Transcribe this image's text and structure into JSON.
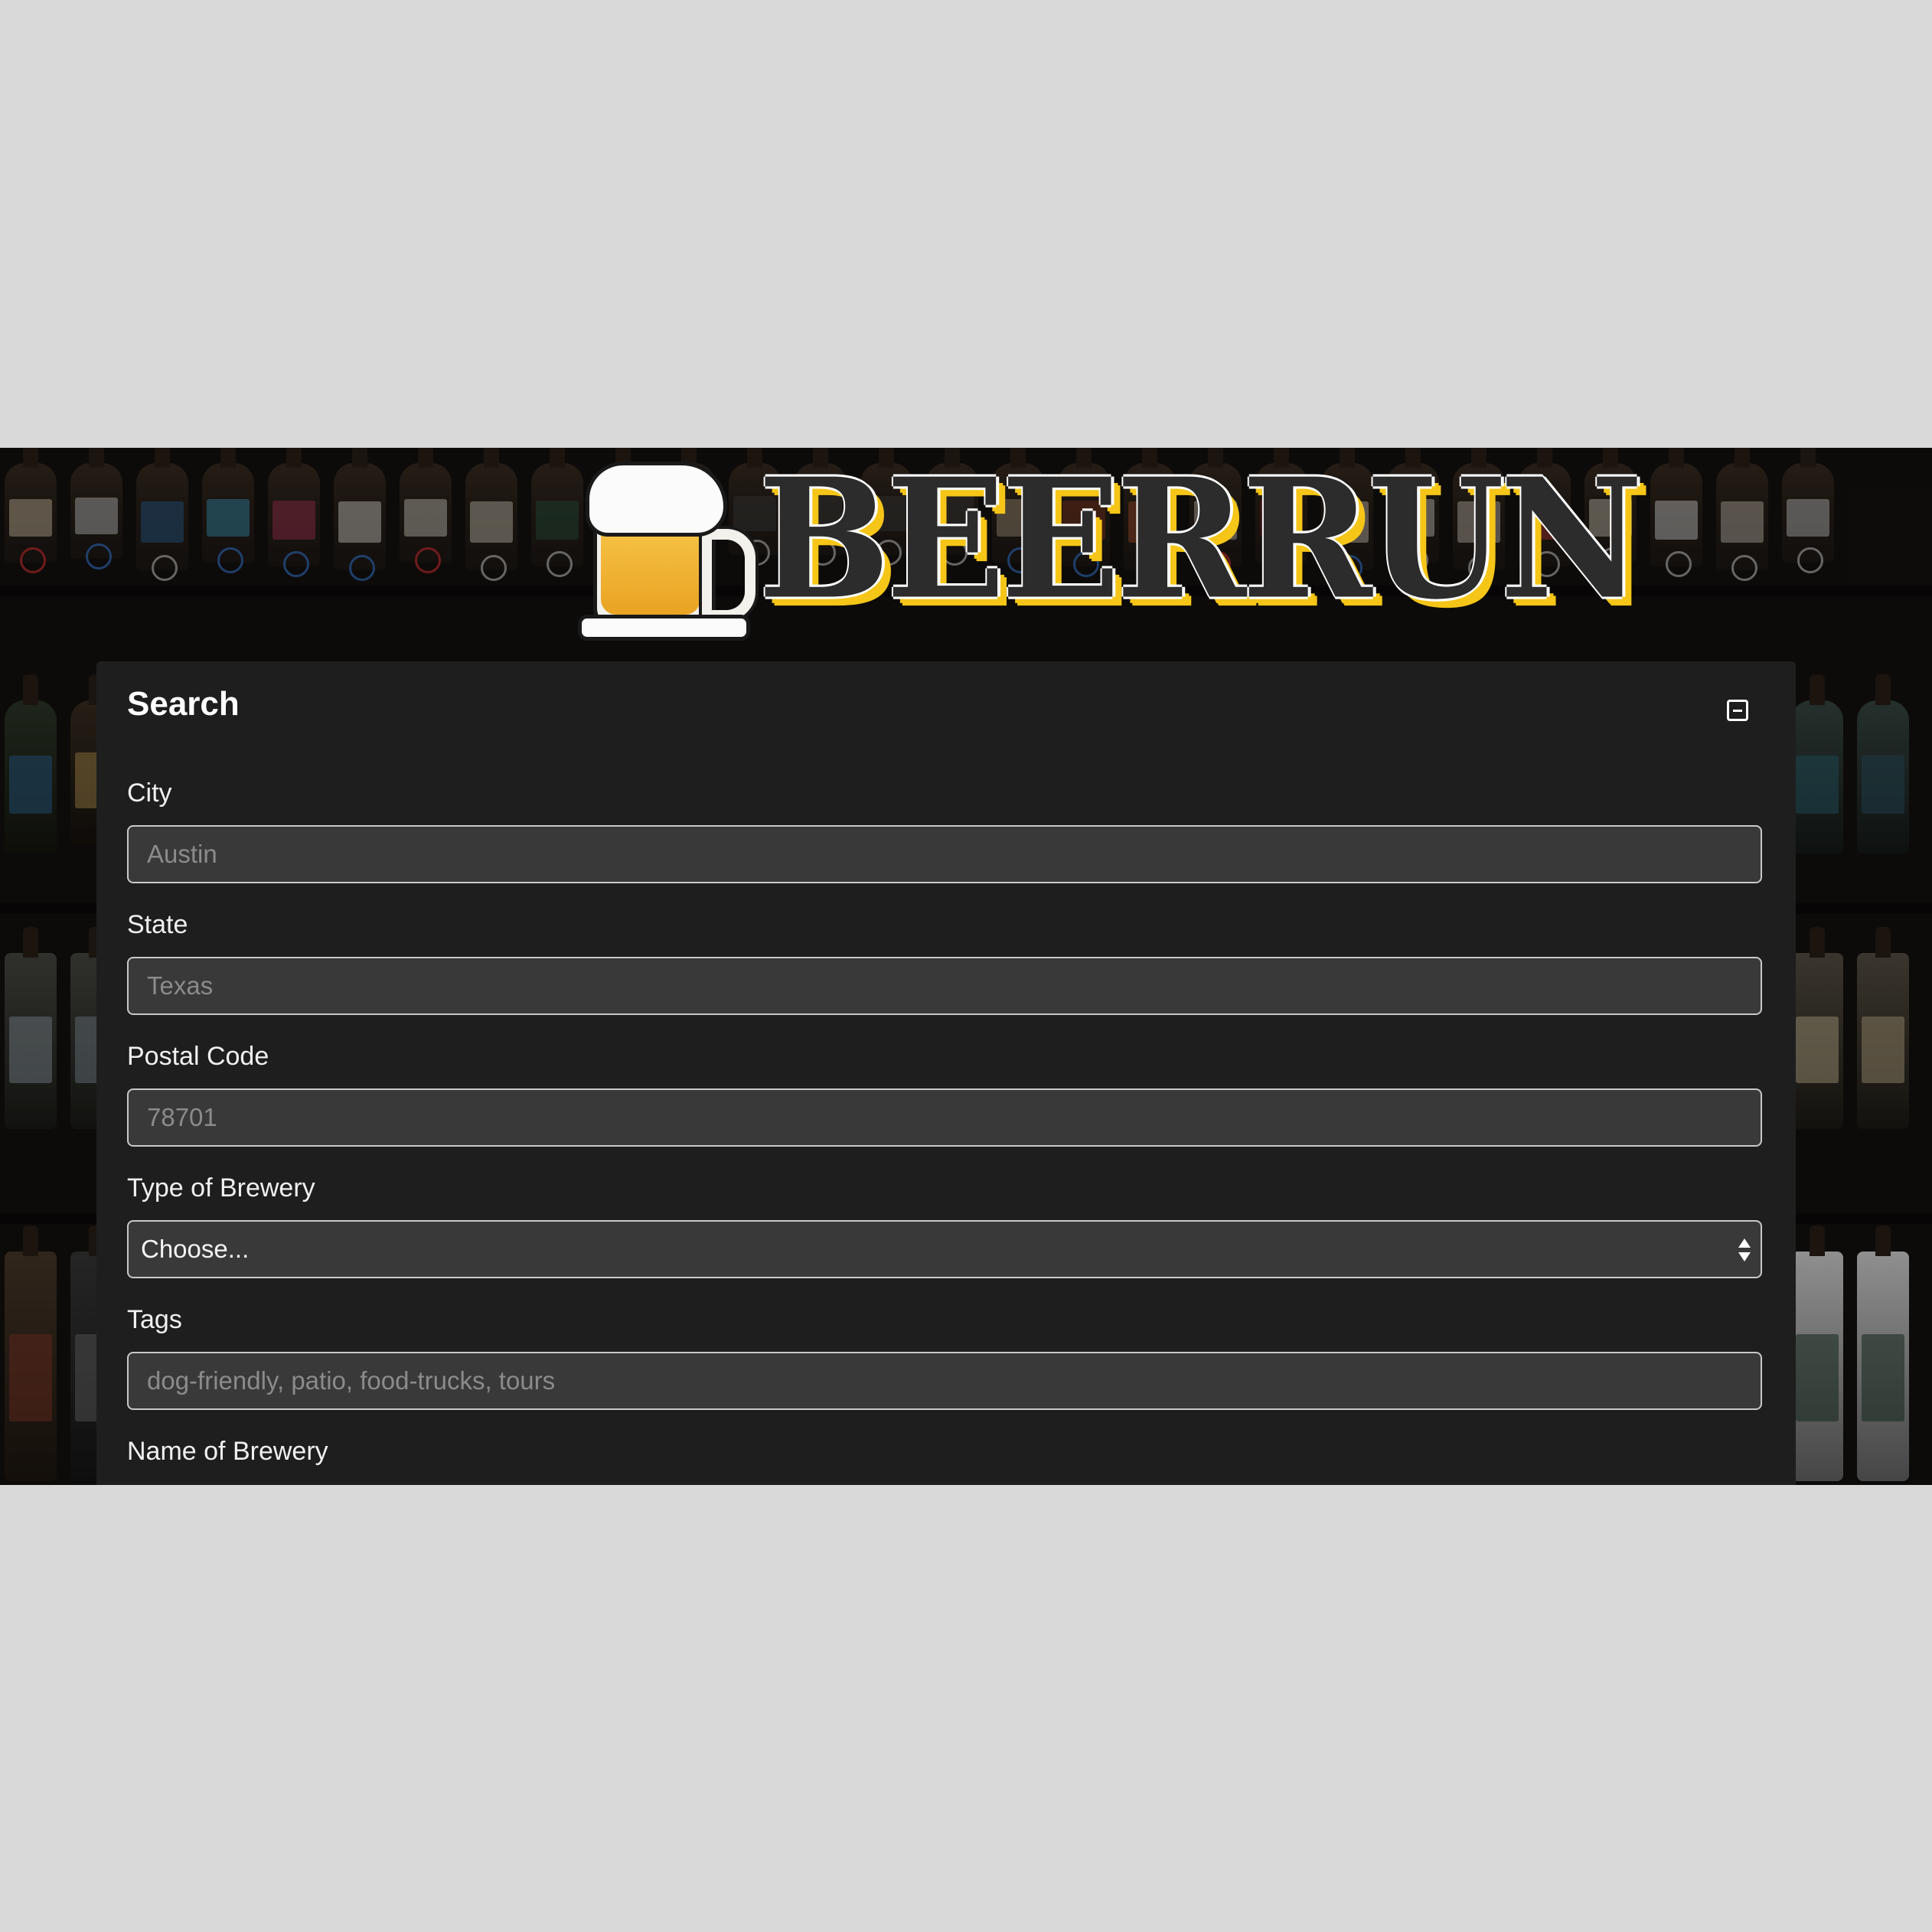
{
  "brand": {
    "logo_text": "BEERRUN"
  },
  "search_panel": {
    "title": "Search",
    "collapse_icon": "minus-square-icon",
    "fields": {
      "city": {
        "label": "City",
        "placeholder": "Austin",
        "value": ""
      },
      "state": {
        "label": "State",
        "placeholder": "Texas",
        "value": ""
      },
      "postal_code": {
        "label": "Postal Code",
        "placeholder": "78701",
        "value": ""
      },
      "type_of_brewery": {
        "label": "Type of Brewery",
        "selected": "Choose..."
      },
      "tags": {
        "label": "Tags",
        "placeholder": "dog-friendly, patio, food-trucks, tours",
        "value": ""
      },
      "name_of_brewery": {
        "label": "Name of Brewery"
      }
    }
  },
  "colors": {
    "page_background": "#d9d9d9",
    "panel_background": "#1e1e1e",
    "input_background": "#393939",
    "logo_accent": "#f5c518"
  }
}
